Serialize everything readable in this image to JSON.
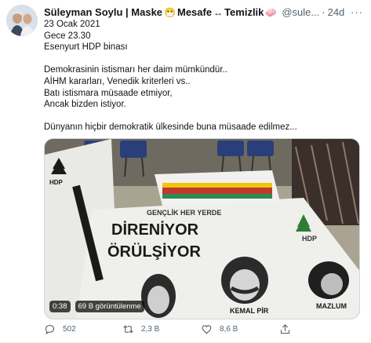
{
  "tweet": {
    "display_name": "Süleyman Soylu | Maske",
    "emoji_mask": "😷",
    "name_part2": "Mesafe",
    "emoji_arrows": "↔",
    "name_part3": "Temizlik",
    "emoji_soap": "🧼",
    "handle": "@sule...",
    "dot": "·",
    "time": "24d",
    "more": "···",
    "lines": [
      "23 Ocak 2021",
      "Gece 23.30",
      "Esenyurt HDP binası",
      "",
      "Demokrasinin istismarı her daim mümkündür..",
      "AİHM kararları, Venedik kriterleri vs..",
      "Batı istismara müsaade etmiyor,",
      "Ancak bizden istiyor.",
      "",
      "Dünyanın hiçbir demokratik ülkesinde buna müsaade edilmez..."
    ],
    "media": {
      "duration": "0:38",
      "views": "69 B görüntülenme",
      "banner_text_1": "GENÇLİK HER YERDE",
      "banner_text_2": "DİRENİYOR",
      "banner_text_3": "ÖRÜLŞİYOR",
      "banner_logo": "HDP",
      "banner_name_1": "KEMAL PİR",
      "banner_name_2": "MAZLUM"
    },
    "actions": {
      "reply_count": "502",
      "retweet_count": "2,3 B",
      "like_count": "8,6 B"
    }
  },
  "colors": {
    "text_primary": "#0f1419",
    "text_secondary": "#536471",
    "border": "#cfd9de"
  },
  "icons": [
    "avatar",
    "more-icon",
    "reply-icon",
    "retweet-icon",
    "like-icon",
    "share-icon"
  ]
}
